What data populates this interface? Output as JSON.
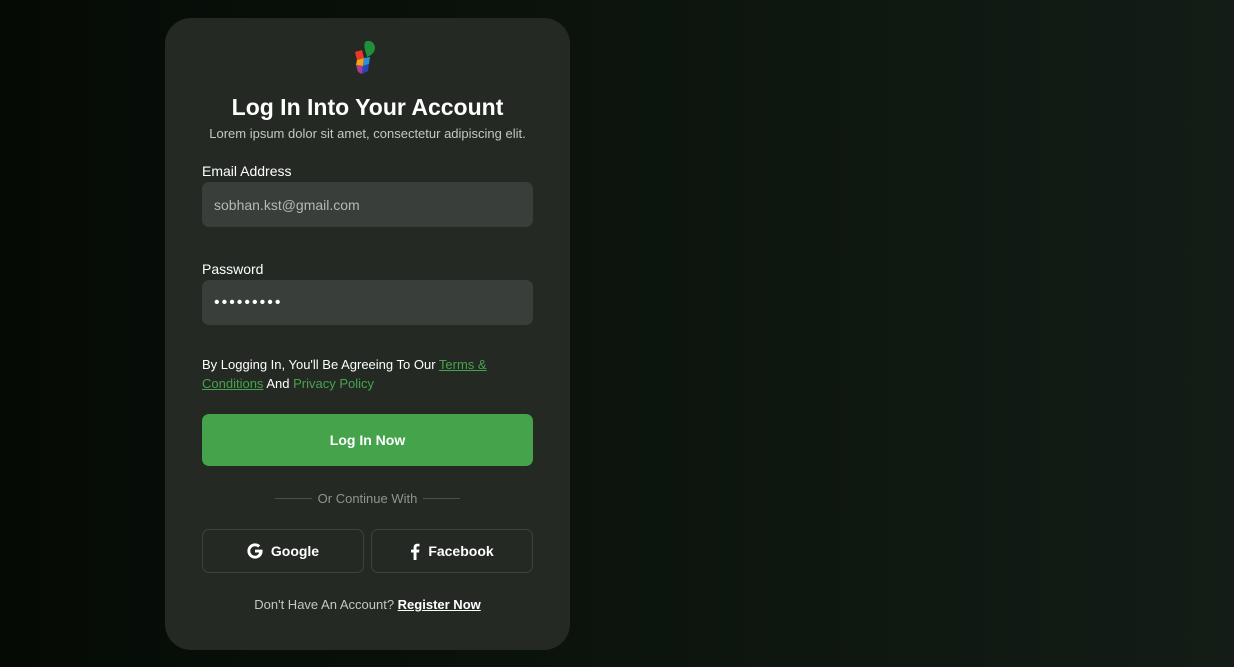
{
  "login": {
    "logo_icon": "multicolor-brand-icon",
    "title": "Log In Into Your Account",
    "subtitle": "Lorem ipsum dolor sit amet, consectetur adipiscing elit.",
    "email": {
      "label": "Email Address",
      "value": "sobhan.kst@gmail.com"
    },
    "password": {
      "label": "Password",
      "value": "•••••••••"
    },
    "terms": {
      "prefix": "By Logging In, You'll Be Agreeing To Our",
      "terms_link": "Terms & Conditions",
      "middle": "And",
      "privacy_link": "Privacy Policy"
    },
    "login_button": "Log In Now",
    "divider_text": "Or Continue With",
    "google_button": "Google",
    "google_icon": "google-icon",
    "facebook_button": "Facebook",
    "facebook_icon": "facebook-icon",
    "register": {
      "prompt": "Don't Have An Account?",
      "link": "Register Now"
    }
  },
  "colors": {
    "accent": "#45a34b",
    "card": "#242924",
    "input": "#393e3a"
  }
}
